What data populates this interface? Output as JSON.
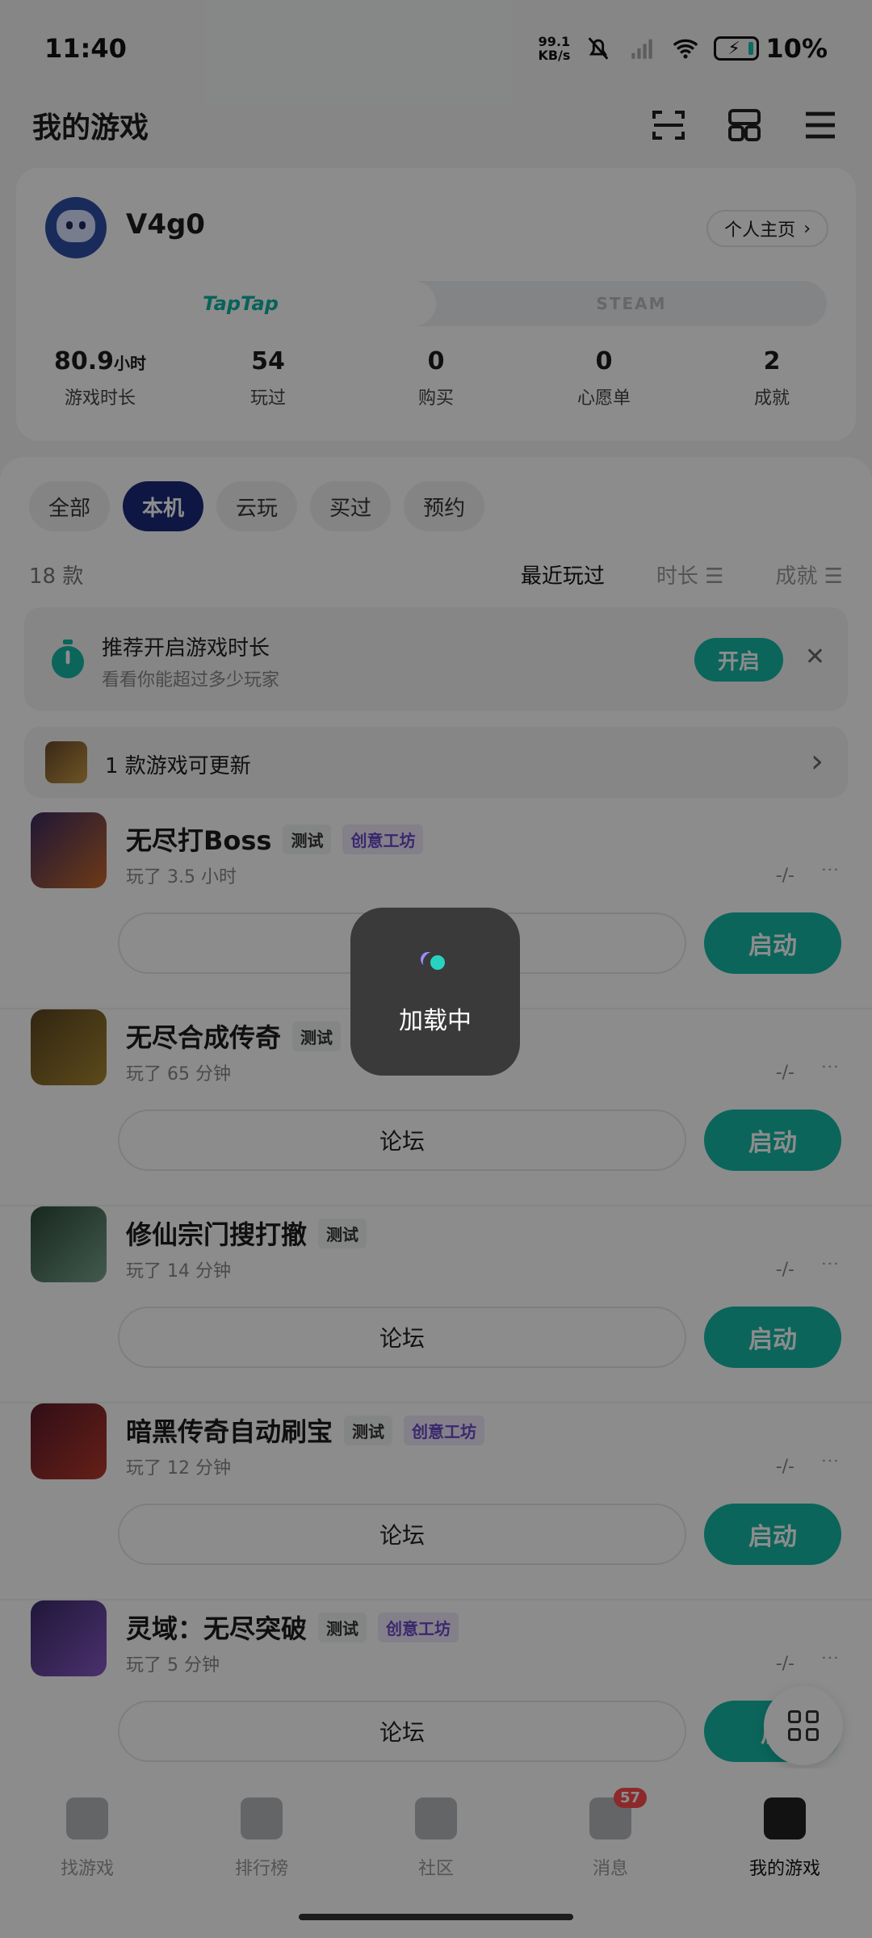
{
  "status": {
    "time": "11:40",
    "speed_top": "99.1",
    "speed_bottom": "KB/s",
    "battery": "10%"
  },
  "header": {
    "title": "我的游戏"
  },
  "profile": {
    "username": "V4g0",
    "homepage_label": "个人主页",
    "platforms": [
      "TapTap",
      "STEAM"
    ],
    "stats": [
      {
        "value": "80.9",
        "unit": "小时",
        "label": "游戏时长"
      },
      {
        "value": "54",
        "unit": "",
        "label": "玩过"
      },
      {
        "value": "0",
        "unit": "",
        "label": "购买"
      },
      {
        "value": "0",
        "unit": "",
        "label": "心愿单"
      },
      {
        "value": "2",
        "unit": "",
        "label": "成就"
      }
    ]
  },
  "filters": [
    "全部",
    "本机",
    "云玩",
    "买过",
    "预约"
  ],
  "list": {
    "count": "18 款",
    "sorts": [
      "最近玩过",
      "时长 ☰",
      "成就 ☰"
    ]
  },
  "banner": {
    "title": "推荐开启游戏时长",
    "subtitle": "看看你能超过多少玩家",
    "button": "开启"
  },
  "update": {
    "text": "1 款游戏可更新"
  },
  "games": [
    {
      "name": "无尽打Boss",
      "tags": [
        "测试",
        "创意工坊"
      ],
      "time": "玩了 3.5 小时",
      "forum": "论坛",
      "launch": "启动",
      "color1": "#3b2a63",
      "color2": "#c76a2a"
    },
    {
      "name": "无尽合成传奇",
      "tags": [
        "测试"
      ],
      "time": "玩了 65 分钟",
      "forum": "论坛",
      "launch": "启动",
      "color1": "#5a4520",
      "color2": "#a98832"
    },
    {
      "name": "修仙宗门搜打撤",
      "tags": [
        "测试"
      ],
      "time": "玩了 14 分钟",
      "forum": "论坛",
      "launch": "启动",
      "color1": "#2c4a3a",
      "color2": "#7aa38f"
    },
    {
      "name": "暗黑传奇自动刷宝",
      "tags": [
        "测试",
        "创意工坊"
      ],
      "time": "玩了 12 分钟",
      "forum": "论坛",
      "launch": "启动",
      "color1": "#5a1a2a",
      "color2": "#b83a2a"
    },
    {
      "name": "灵域：无尽突破",
      "tags": [
        "测试",
        "创意工坊"
      ],
      "time": "玩了 5 分钟",
      "forum": "论坛",
      "launch": "启",
      "color1": "#3a2a6a",
      "color2": "#8a5ac8"
    }
  ],
  "dash_text": "-/-",
  "nav": [
    {
      "label": "找游戏",
      "badge": ""
    },
    {
      "label": "排行榜",
      "badge": ""
    },
    {
      "label": "社区",
      "badge": ""
    },
    {
      "label": "消息",
      "badge": "57"
    },
    {
      "label": "我的游戏",
      "badge": ""
    }
  ],
  "loading": {
    "text": "加载中"
  },
  "colors": {
    "accent": "#14b8a6",
    "active_chip": "#1a2a7a",
    "badge": "#ff4d4f"
  }
}
